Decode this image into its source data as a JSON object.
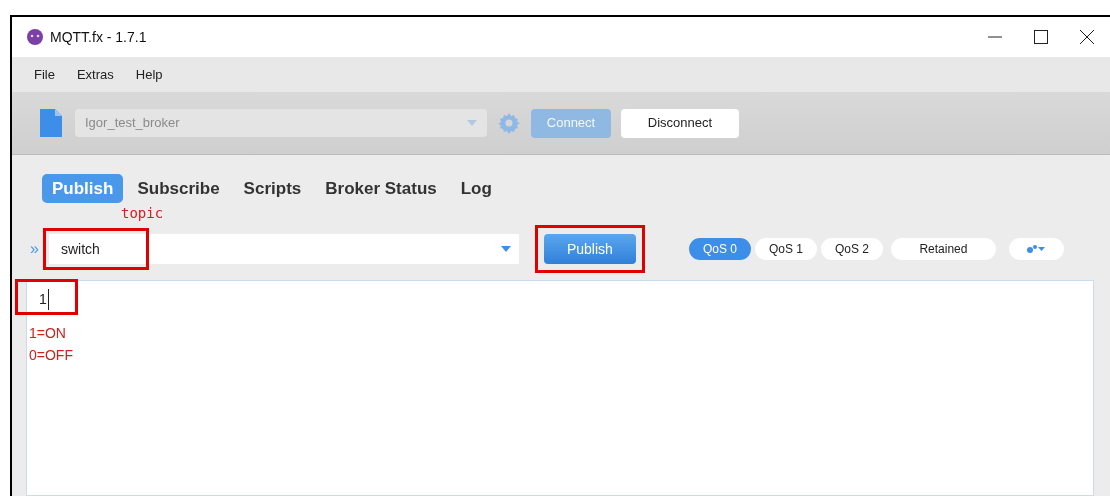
{
  "window": {
    "title": "MQTT.fx - 1.7.1"
  },
  "menu": [
    "File",
    "Extras",
    "Help"
  ],
  "toolbar": {
    "profile": {
      "value": "Igor_test_broker",
      "disabled": true
    },
    "connect": {
      "label": "Connect",
      "disabled": true
    },
    "disconnect": {
      "label": "Disconnect",
      "disabled": false
    }
  },
  "tabs": [
    {
      "label": "Publish",
      "selected": true
    },
    {
      "label": "Subscribe",
      "selected": false
    },
    {
      "label": "Scripts",
      "selected": false
    },
    {
      "label": "Broker Status",
      "selected": false
    },
    {
      "label": "Log",
      "selected": false
    }
  ],
  "annotation_topic": "topic",
  "expand_glyph": "»",
  "topic": {
    "value": "switch"
  },
  "publish_button": "Publish",
  "qos": [
    {
      "label": "QoS 0",
      "selected": true
    },
    {
      "label": "QoS 1",
      "selected": false
    },
    {
      "label": "QoS 2",
      "selected": false
    }
  ],
  "retained": {
    "label": "Retained",
    "selected": false
  },
  "payload": {
    "value": "1"
  },
  "annotation_notes": [
    "1=ON",
    "0=OFF"
  ]
}
